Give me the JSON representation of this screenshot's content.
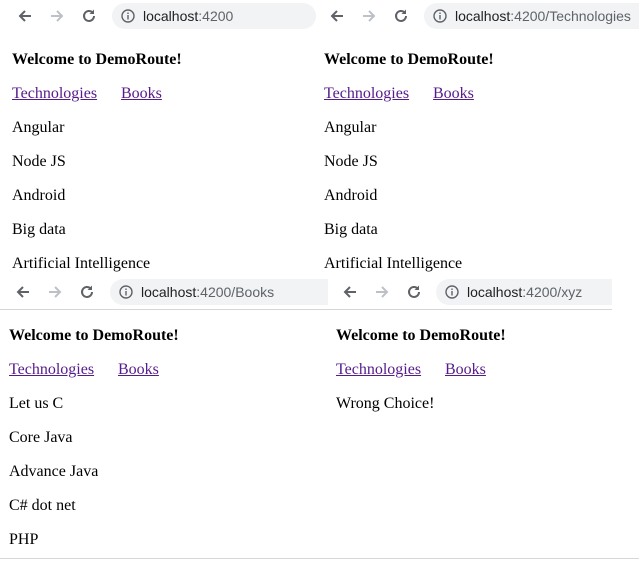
{
  "windows": [
    {
      "url_host": "localhost",
      "url_path": ":4200",
      "heading": "Welcome to DemoRoute!",
      "nav_links": [
        "Technologies",
        "Books"
      ],
      "items": [
        "Angular",
        "Node JS",
        "Android",
        "Big data",
        "Artificial Intelligence"
      ]
    },
    {
      "url_host": "localhost",
      "url_path": ":4200/Technologies",
      "heading": "Welcome to DemoRoute!",
      "nav_links": [
        "Technologies",
        "Books"
      ],
      "items": [
        "Angular",
        "Node JS",
        "Android",
        "Big data",
        "Artificial Intelligence"
      ]
    },
    {
      "url_host": "localhost",
      "url_path": ":4200/Books",
      "heading": "Welcome to DemoRoute!",
      "nav_links": [
        "Technologies",
        "Books"
      ],
      "items": [
        "Let us C",
        "Core Java",
        "Advance Java",
        "C# dot net",
        "PHP"
      ]
    },
    {
      "url_host": "localhost",
      "url_path": ":4200/xyz",
      "heading": "Welcome to DemoRoute!",
      "nav_links": [
        "Technologies",
        "Books"
      ],
      "items": [
        "Wrong Choice!"
      ]
    }
  ],
  "icons": {
    "back": "back-arrow-icon",
    "forward": "forward-arrow-icon",
    "reload": "reload-icon",
    "info": "info-icon"
  },
  "colors": {
    "link": "#551a8b",
    "omnibox_bg": "#f1f3f4",
    "icon": "#5f6368",
    "icon_disabled": "#bdc1c6"
  }
}
